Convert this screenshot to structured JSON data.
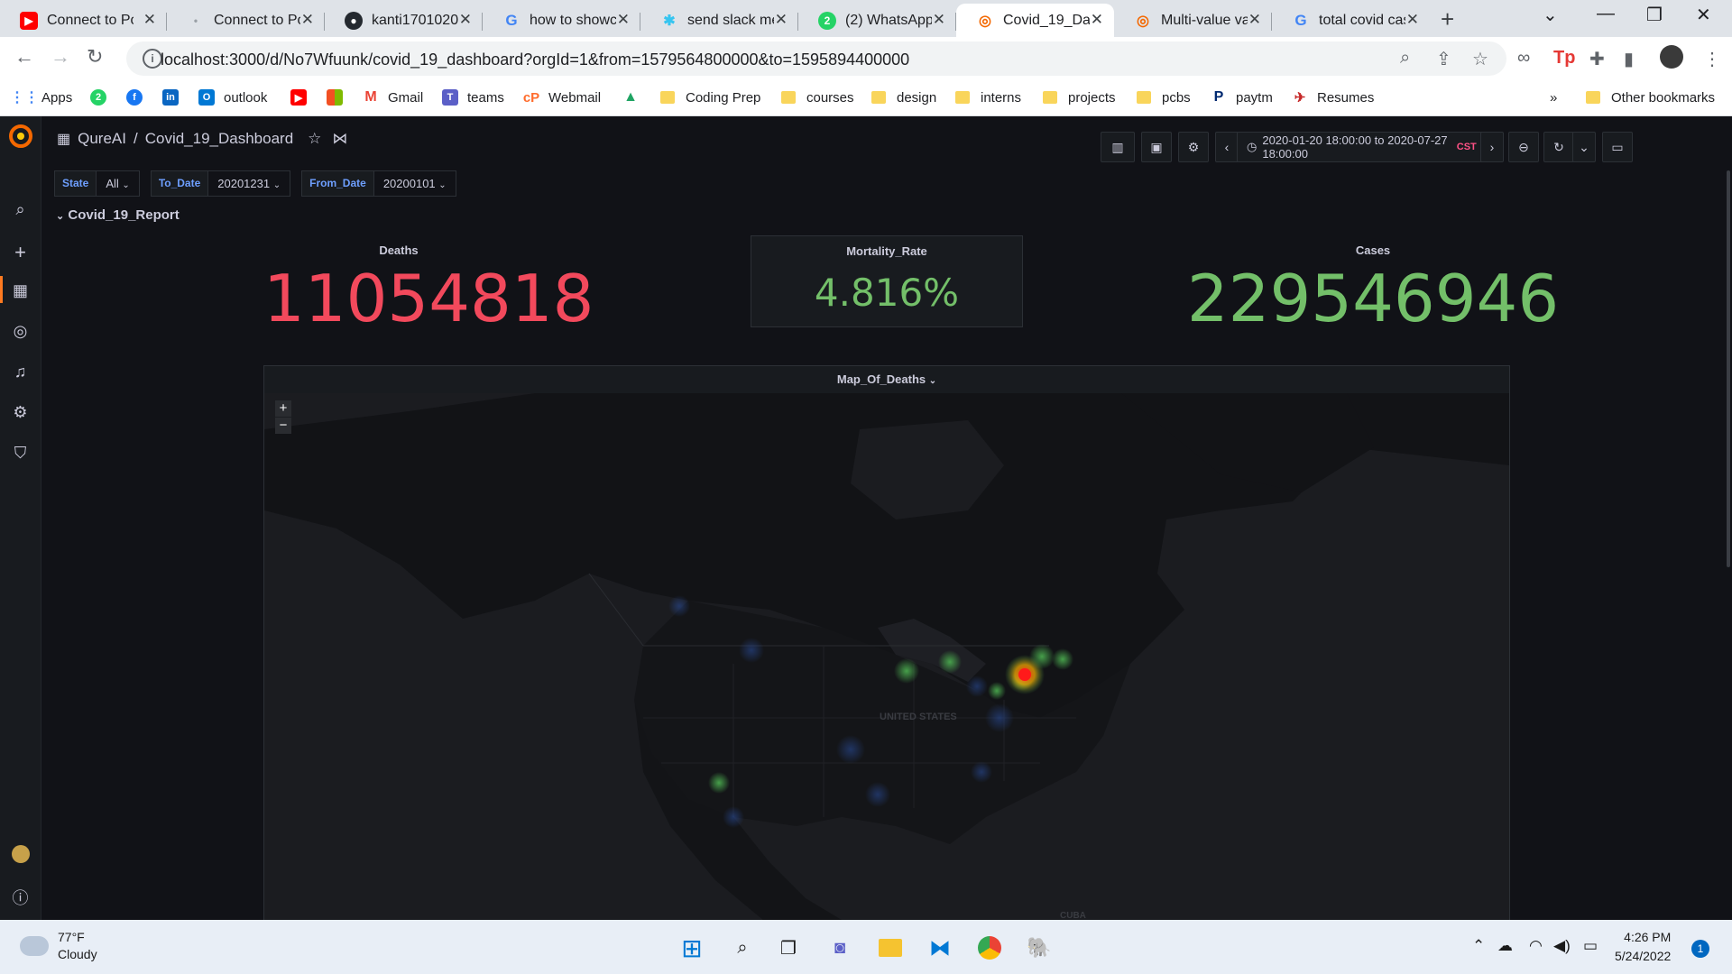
{
  "browser": {
    "tabs": [
      {
        "title": "Connect to Po",
        "icon": "youtube-icon",
        "color": "#ff0000"
      },
      {
        "title": "Connect to Po",
        "icon": "page-icon",
        "color": "#9aa0a6"
      },
      {
        "title": "kanti1701020",
        "icon": "github-icon",
        "color": "#24292f"
      },
      {
        "title": "how to showc",
        "icon": "google-icon",
        "color": "#4285f4"
      },
      {
        "title": "send slack me",
        "icon": "slack-icon",
        "color": "#36c5f0"
      },
      {
        "title": "(2) WhatsApp",
        "icon": "whatsapp-icon",
        "color": "#25d366"
      },
      {
        "title": "Covid_19_Das",
        "icon": "grafana-icon",
        "color": "#f46800"
      },
      {
        "title": "Multi-value va",
        "icon": "grafana-icon",
        "color": "#f46800"
      },
      {
        "title": "total covid cas",
        "icon": "google-icon",
        "color": "#4285f4"
      }
    ],
    "url": "localhost:3000/d/No7Wfuunk/covid_19_dashboard?orgId=1&from=1579564800000&to=1595894400000",
    "bookmarks": [
      {
        "label": "Apps",
        "icon": "apps-grid-icon"
      },
      {
        "label": "",
        "icon": "whatsapp-icon"
      },
      {
        "label": "",
        "icon": "facebook-icon"
      },
      {
        "label": "",
        "icon": "linkedin-icon"
      },
      {
        "label": "outlook",
        "icon": "outlook-icon"
      },
      {
        "label": "",
        "icon": "youtube-icon"
      },
      {
        "label": "",
        "icon": "microsoft-icon"
      },
      {
        "label": "Gmail",
        "icon": "gmail-icon"
      },
      {
        "label": "teams",
        "icon": "teams-icon"
      },
      {
        "label": "Webmail",
        "icon": "webmail-icon"
      },
      {
        "label": "",
        "icon": "drive-icon"
      },
      {
        "label": "Coding Prep",
        "icon": "folder-icon"
      },
      {
        "label": "courses",
        "icon": "folder-icon"
      },
      {
        "label": "design",
        "icon": "folder-icon"
      },
      {
        "label": "interns",
        "icon": "folder-icon"
      },
      {
        "label": "projects",
        "icon": "folder-icon"
      },
      {
        "label": "pcbs",
        "icon": "folder-icon"
      },
      {
        "label": "paytm",
        "icon": "paytm-icon"
      },
      {
        "label": "Resumes",
        "icon": "resumes-icon"
      }
    ],
    "overflow": "»",
    "other_bookmarks": "Other bookmarks"
  },
  "grafana": {
    "org": "QureAI",
    "separator": "/",
    "dashboard": "Covid_19_Dashboard",
    "time_range": "2020-01-20 18:00:00 to 2020-07-27 18:00:00",
    "timezone": "CST",
    "variables": [
      {
        "label": "State",
        "value": "All"
      },
      {
        "label": "To_Date",
        "value": "20201231"
      },
      {
        "label": "From_Date",
        "value": "20200101"
      }
    ],
    "row_title": "Covid_19_Report",
    "stats": {
      "deaths": {
        "title": "Deaths",
        "value": "11054818",
        "color": "#f2495c"
      },
      "mortality": {
        "title": "Mortality_Rate",
        "value": "4.816%",
        "color": "#73bf69"
      },
      "cases": {
        "title": "Cases",
        "value": "229546946",
        "color": "#73bf69"
      }
    },
    "map": {
      "title": "Map_Of_Deaths",
      "label_us": "UNITED STATES",
      "label_cuba": "CUBA",
      "zoom_in": "+",
      "zoom_out": "−"
    }
  },
  "taskbar": {
    "temp": "77°F",
    "condition": "Cloudy",
    "time": "4:26 PM",
    "date": "5/24/2022",
    "notifications": "1"
  }
}
